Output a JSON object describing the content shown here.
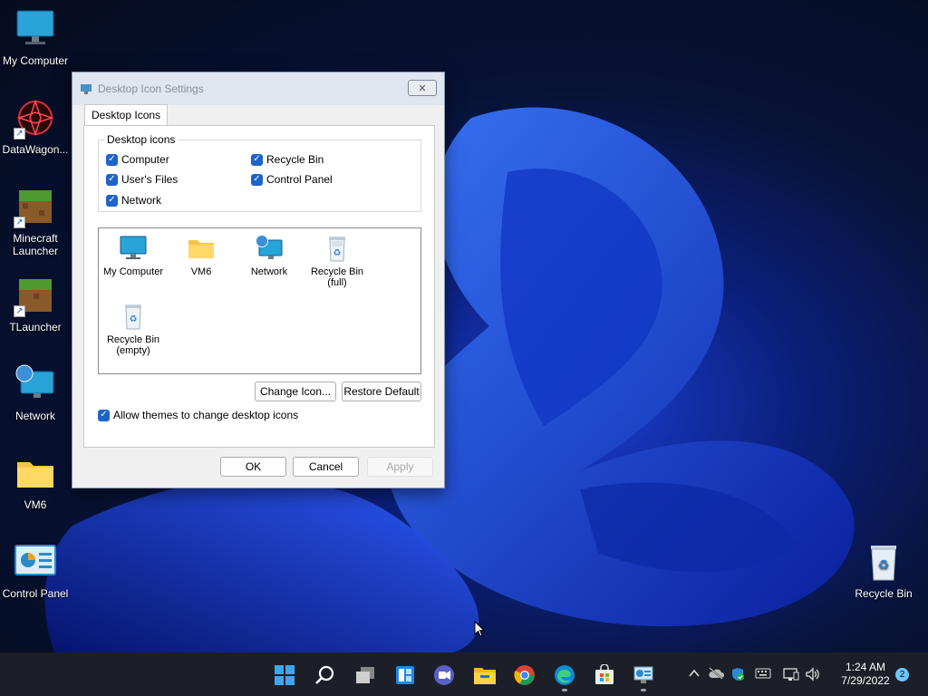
{
  "desktop": {
    "icons": [
      {
        "label": "My Computer"
      },
      {
        "label": "DataWagon..."
      },
      {
        "label": "Minecraft Launcher"
      },
      {
        "label": "TLauncher"
      },
      {
        "label": "Network"
      },
      {
        "label": "VM6"
      },
      {
        "label": "Control Panel"
      },
      {
        "label": "Recycle Bin"
      }
    ]
  },
  "dialog": {
    "title": "Desktop Icon Settings",
    "close_label": "✕",
    "tab_label": "Desktop Icons",
    "group_label": "Desktop icons",
    "checkboxes": [
      {
        "label": "Computer",
        "checked": true
      },
      {
        "label": "Recycle Bin",
        "checked": true
      },
      {
        "label": "User's Files",
        "checked": true
      },
      {
        "label": "Control Panel",
        "checked": true
      },
      {
        "label": "Network",
        "checked": true
      }
    ],
    "preview_items": [
      {
        "label": "My Computer"
      },
      {
        "label": "VM6"
      },
      {
        "label": "Network"
      },
      {
        "label": "Recycle Bin\n(full)"
      },
      {
        "label": "Recycle Bin\n(empty)"
      }
    ],
    "change_icon_label": "Change Icon...",
    "restore_default_label": "Restore Default",
    "allow_themes_label": "Allow themes to change desktop icons",
    "allow_themes_checked": true,
    "ok_label": "OK",
    "cancel_label": "Cancel",
    "apply_label": "Apply"
  },
  "taskbar": {
    "apps": [
      "start-icon",
      "search-icon",
      "task-view-icon",
      "widgets-icon",
      "chat-icon",
      "file-explorer-icon",
      "chrome-icon",
      "edge-icon",
      "store-icon",
      "control-panel-icon"
    ],
    "tray_icons": [
      "chevron-up-icon",
      "onedrive-icon",
      "defender-icon",
      "keyboard-icon",
      "display-icon",
      "volume-icon"
    ],
    "time": "1:24 AM",
    "date": "7/29/2022",
    "notification_count": "2"
  },
  "colors": {
    "accent": "#1e64c8",
    "taskbar": "#1c1f27",
    "wallpaper_blue": "#1a3fd6"
  }
}
